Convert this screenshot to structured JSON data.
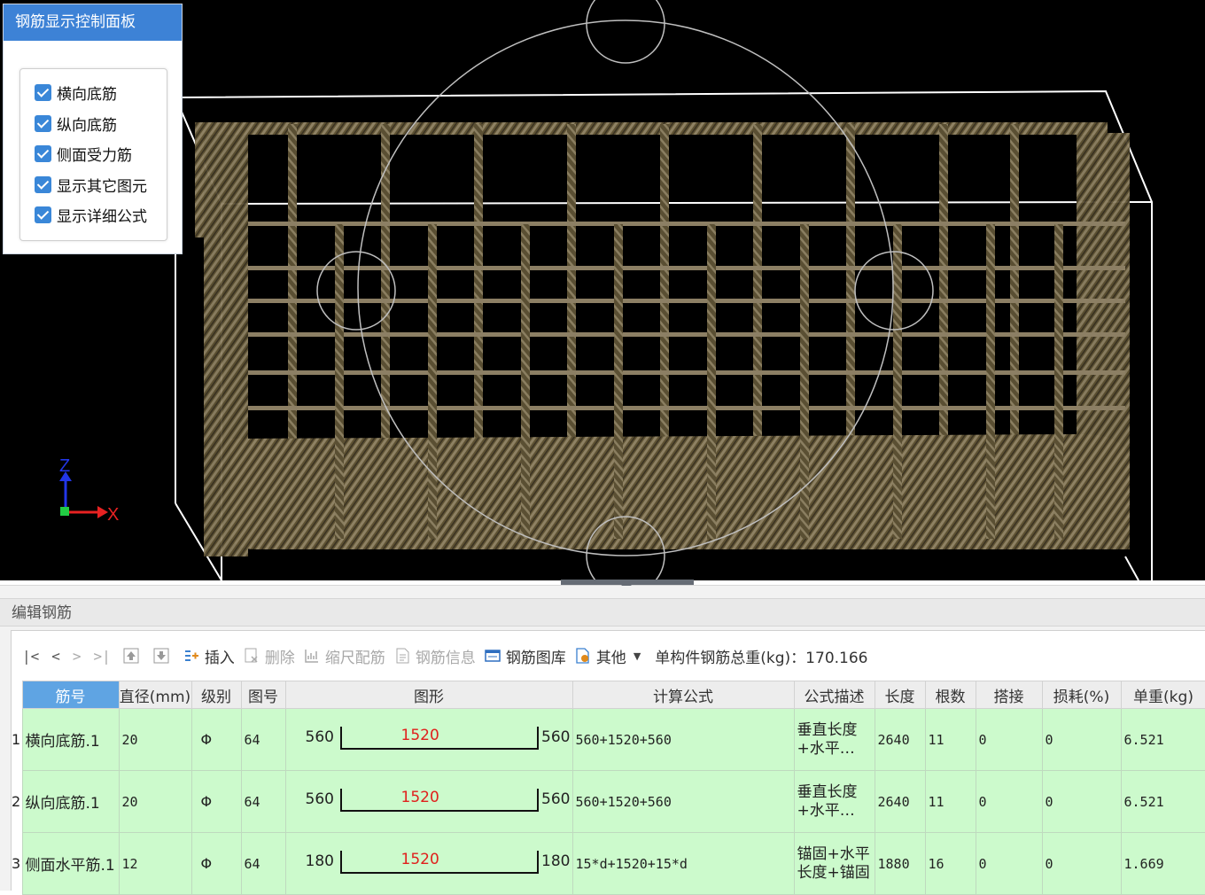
{
  "control_panel": {
    "title": "钢筋显示控制面板",
    "options": [
      {
        "label": "横向底筋",
        "checked": true
      },
      {
        "label": "纵向底筋",
        "checked": true
      },
      {
        "label": "侧面受力筋",
        "checked": true
      },
      {
        "label": "显示其它图元",
        "checked": true
      },
      {
        "label": "显示详细公式",
        "checked": true
      }
    ]
  },
  "axes": {
    "z_label": "Z",
    "x_label": "X"
  },
  "editor": {
    "title": "编辑钢筋",
    "toolbar": {
      "nav_first": "|<",
      "nav_prev": "<",
      "nav_next": ">",
      "nav_last": ">|",
      "insert": "插入",
      "delete": "删除",
      "scale": "缩尺配筋",
      "info": "钢筋信息",
      "library": "钢筋图库",
      "other": "其他",
      "total_weight": "单构件钢筋总重(kg)：170.166"
    },
    "columns": [
      "筋号",
      "直径(mm)",
      "级别",
      "图号",
      "图形",
      "计算公式",
      "公式描述",
      "长度",
      "根数",
      "搭接",
      "损耗(%)",
      "单重(kg)"
    ],
    "rows": [
      {
        "num": "1",
        "name": "横向底筋.1",
        "dia": "20",
        "grade": "Φ",
        "fig": "64",
        "left": "560",
        "mid": "1520",
        "right": "560",
        "formula": "560+1520+560",
        "desc": "垂直长度+水平…",
        "len": "2640",
        "count": "11",
        "lap": "0",
        "loss": "0",
        "weight": "6.521"
      },
      {
        "num": "2",
        "name": "纵向底筋.1",
        "dia": "20",
        "grade": "Φ",
        "fig": "64",
        "left": "560",
        "mid": "1520",
        "right": "560",
        "formula": "560+1520+560",
        "desc": "垂直长度+水平…",
        "len": "2640",
        "count": "11",
        "lap": "0",
        "loss": "0",
        "weight": "6.521"
      },
      {
        "num": "3",
        "name": "侧面水平筋.1",
        "dia": "12",
        "grade": "Φ",
        "fig": "64",
        "left": "180",
        "mid": "1520",
        "right": "180",
        "formula": "15*d+1520+15*d",
        "desc": "锚固+水平长度+锚固",
        "len": "1880",
        "count": "16",
        "lap": "0",
        "loss": "0",
        "weight": "1.669"
      }
    ]
  }
}
